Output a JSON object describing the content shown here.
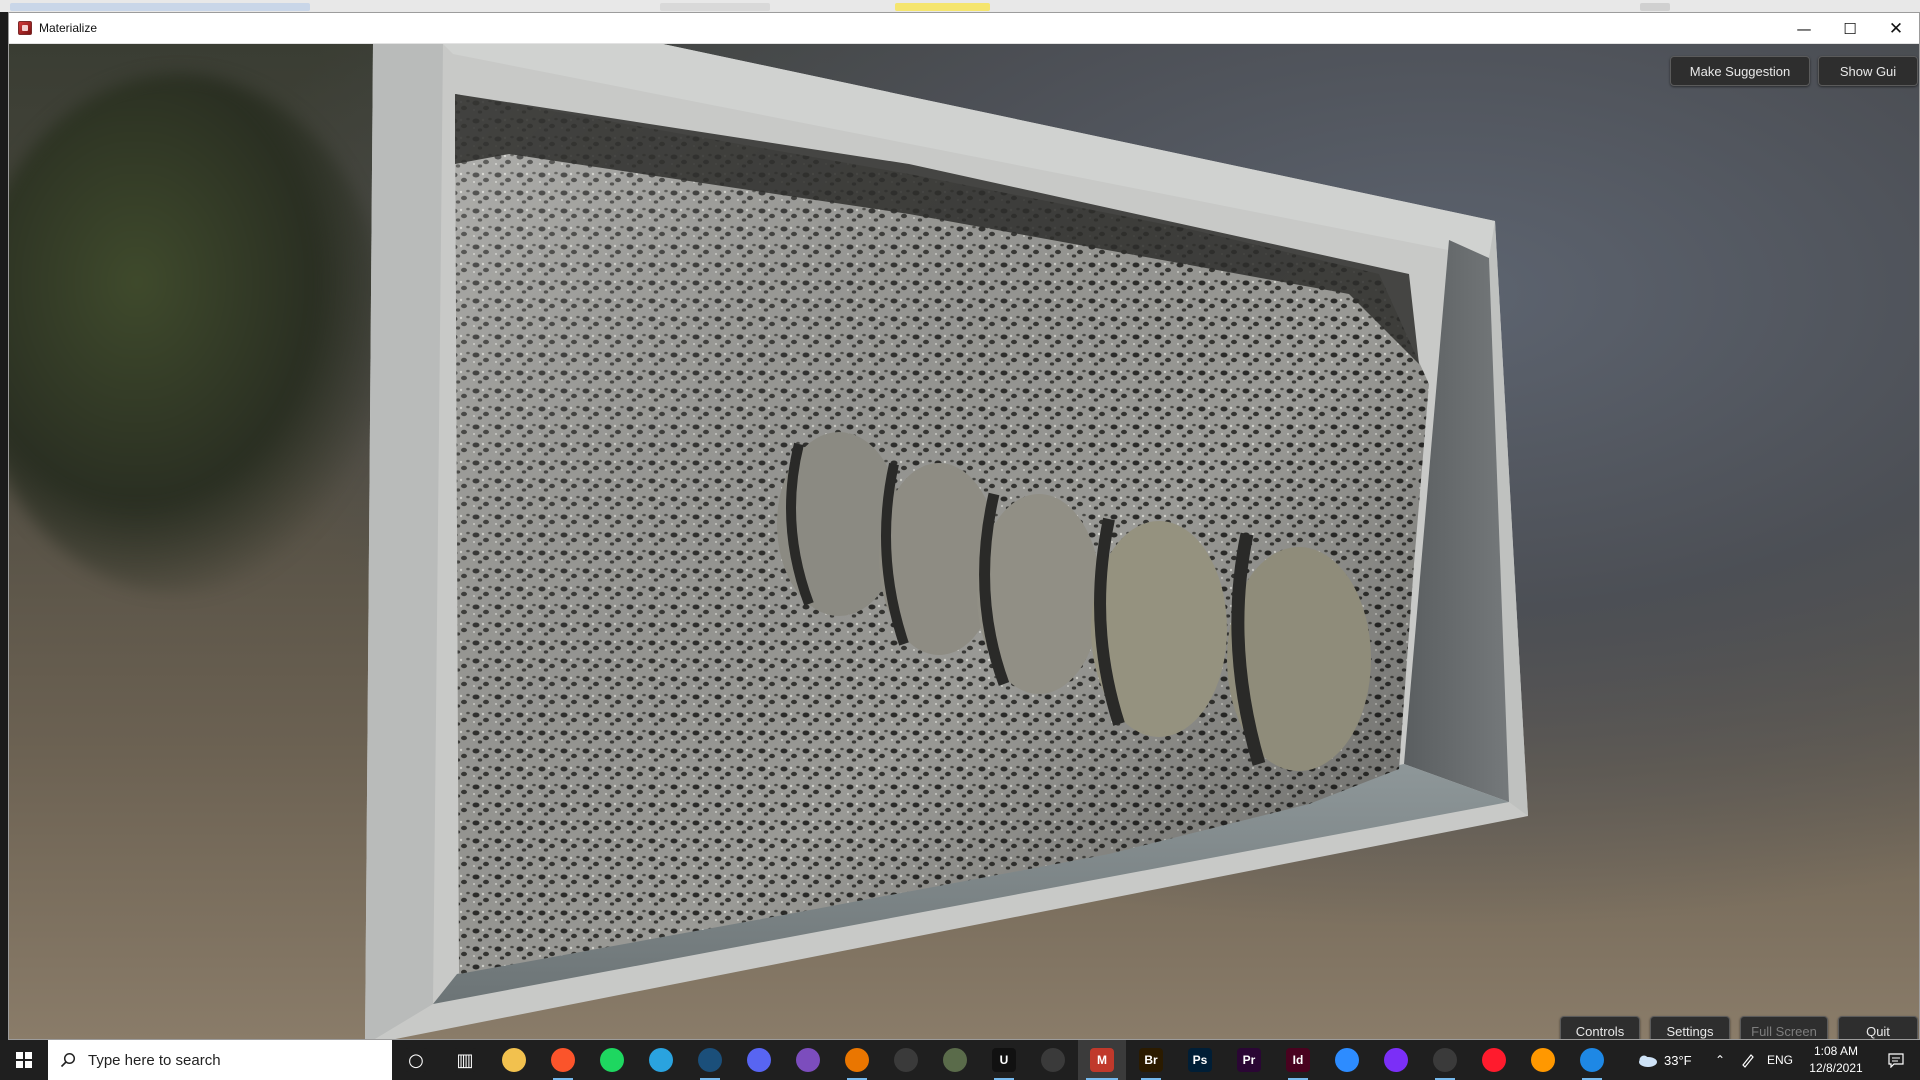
{
  "window": {
    "title": "Materialize",
    "app_icon": "materialize-icon",
    "controls": {
      "minimize": "—",
      "maximize": "☐",
      "close": "✕"
    }
  },
  "overlay_top": {
    "make_suggestion": "Make Suggestion",
    "show_gui": "Show Gui"
  },
  "overlay_bottom": {
    "controls": "Controls",
    "settings": "Settings",
    "full_screen": "Full Screen",
    "quit": "Quit"
  },
  "taskbar": {
    "search_placeholder": "Type here to search",
    "pinned": [
      {
        "name": "cortana-icon",
        "glyph": "○",
        "color": "#1f1f1f"
      },
      {
        "name": "task-view-icon",
        "glyph": "▥",
        "color": "#1f1f1f"
      },
      {
        "name": "file-explorer-icon",
        "glyph": "",
        "color": "#f2c14e"
      },
      {
        "name": "brave-icon",
        "glyph": "",
        "color": "#fb542b"
      },
      {
        "name": "spotify-icon",
        "glyph": "",
        "color": "#1ed760"
      },
      {
        "name": "telegram-icon",
        "glyph": "",
        "color": "#2aa3df"
      },
      {
        "name": "steam-icon",
        "glyph": "",
        "color": "#1b4f7a"
      },
      {
        "name": "discord-icon",
        "glyph": "",
        "color": "#5865f2"
      },
      {
        "name": "github-desktop-icon",
        "glyph": "",
        "color": "#7c4dbd"
      },
      {
        "name": "blender-icon",
        "glyph": "",
        "color": "#ea7600"
      },
      {
        "name": "visual-studio-code-icon",
        "glyph": "",
        "color": "#3a3a3a"
      },
      {
        "name": "substance-icon",
        "glyph": "",
        "color": "#5a6b4a"
      },
      {
        "name": "unreal-engine-icon",
        "glyph": "U",
        "color": "#111111"
      },
      {
        "name": "edge-icon",
        "glyph": "",
        "color": "#3a3a3a"
      },
      {
        "name": "materialize-taskbar-icon",
        "glyph": "M",
        "color": "#c0392b"
      },
      {
        "name": "bridge-icon",
        "glyph": "Br",
        "color": "#2b1b00"
      },
      {
        "name": "photoshop-icon",
        "glyph": "Ps",
        "color": "#001e36"
      },
      {
        "name": "premiere-icon",
        "glyph": "Pr",
        "color": "#2a0634"
      },
      {
        "name": "indesign-icon",
        "glyph": "Id",
        "color": "#49021f"
      },
      {
        "name": "zoom-icon",
        "glyph": "",
        "color": "#2d8cff"
      },
      {
        "name": "podcast-icon",
        "glyph": "",
        "color": "#7b2ff7"
      },
      {
        "name": "books-icon",
        "glyph": "",
        "color": "#3a3a3a"
      },
      {
        "name": "opera-icon",
        "glyph": "",
        "color": "#ff1b2d"
      },
      {
        "name": "sublime-text-icon",
        "glyph": "",
        "color": "#ff9800"
      },
      {
        "name": "browser-blue-icon",
        "glyph": "",
        "color": "#1e88e5"
      }
    ],
    "weather": {
      "temp": "33°F",
      "icon": "cloudy-night-icon"
    },
    "language": "ENG",
    "time": "1:08 AM",
    "date": "12/8/2021"
  }
}
